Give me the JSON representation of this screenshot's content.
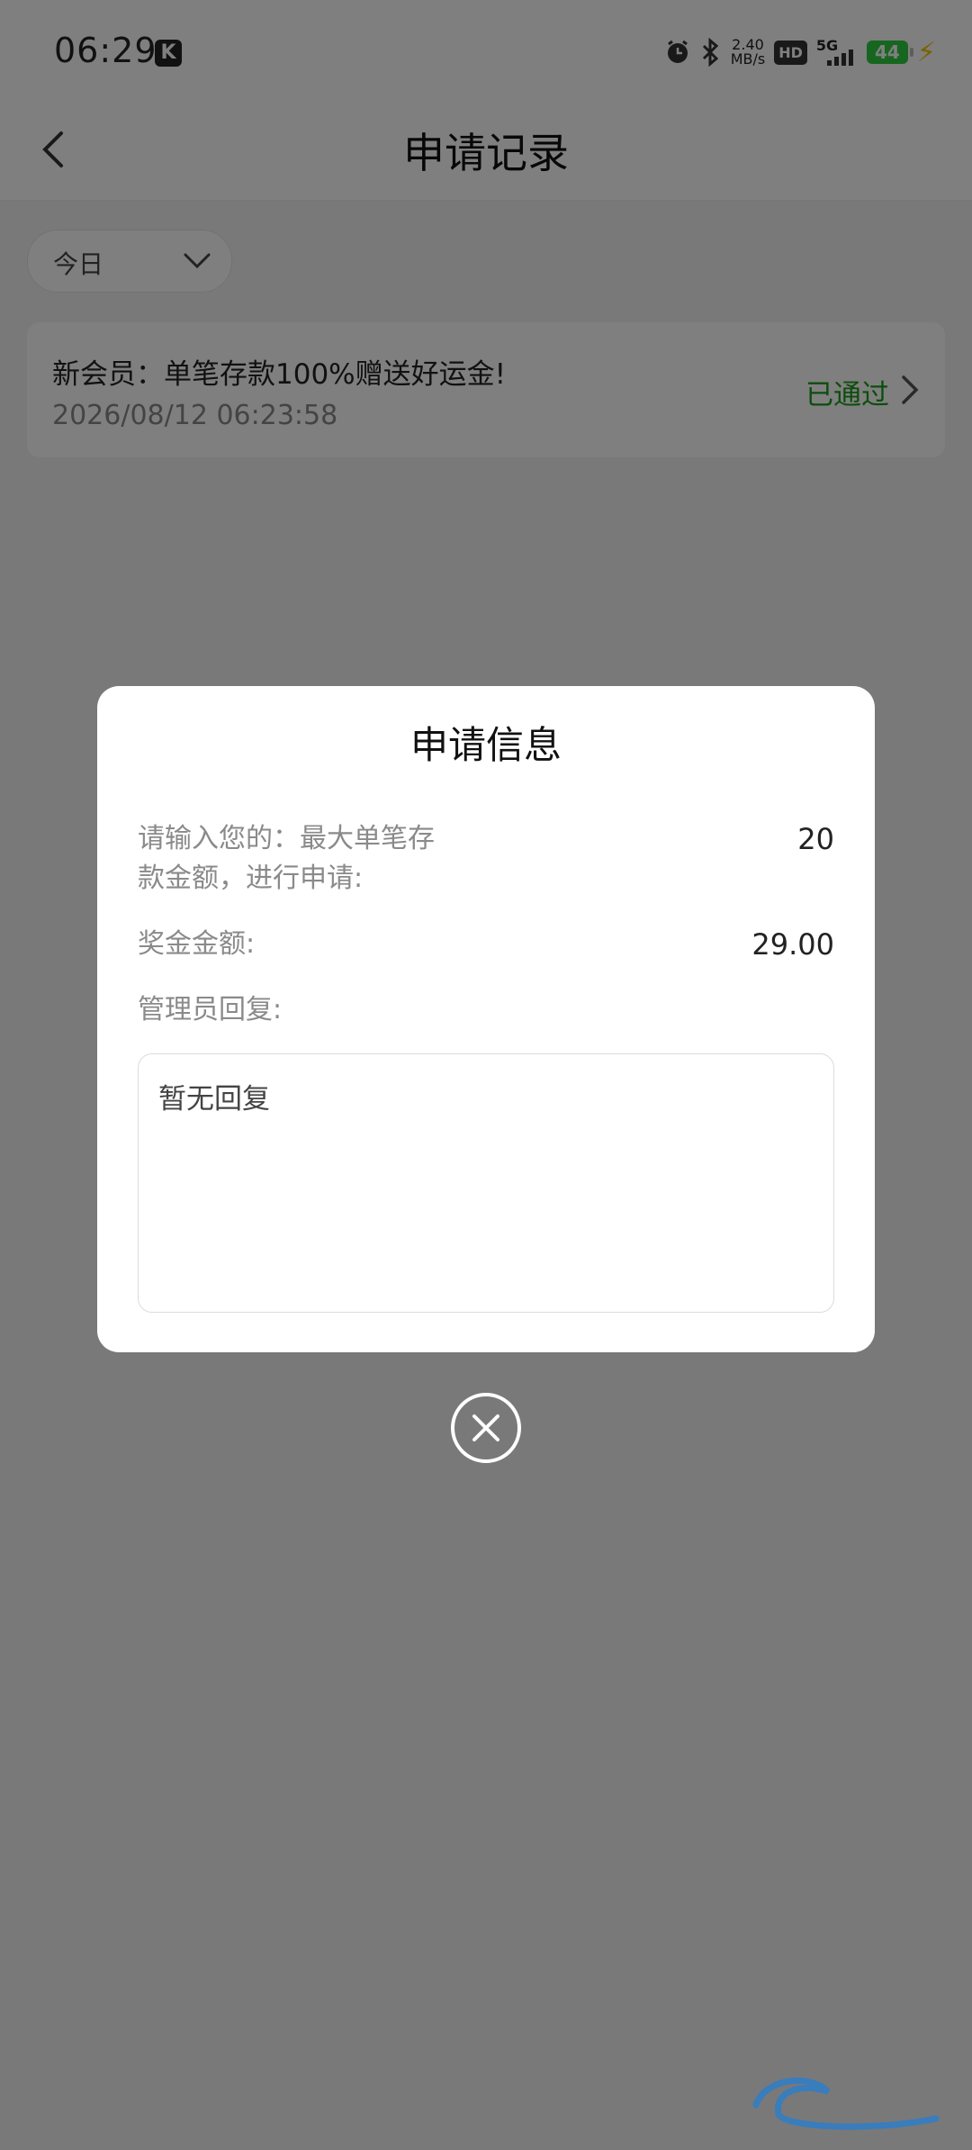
{
  "status_bar": {
    "time": "06:29",
    "app_badge": "K",
    "network_speed_value": "2.40",
    "network_speed_unit": "MB/s",
    "hd_label": "HD",
    "network_type": "5G",
    "battery_level": "44"
  },
  "header": {
    "title": "申请记录"
  },
  "filter": {
    "selected": "今日"
  },
  "records": [
    {
      "title": "新会员：单笔存款100%赠送好运金!",
      "time": "2026/08/12 06:23:58",
      "status": "已通过"
    }
  ],
  "modal": {
    "title": "申请信息",
    "deposit_label_line1": "请输入您的：最大单笔存",
    "deposit_label_line2": "款金额，进行申请:",
    "deposit_value": "20",
    "bonus_label": "奖金金额:",
    "bonus_value": "29.00",
    "reply_label": "管理员回复:",
    "reply_text": "暂无回复"
  },
  "colors": {
    "status_approved": "#1a9a1a",
    "overlay": "rgba(0,0,0,0.5)"
  },
  "icons": {
    "back": "chevron-left-icon",
    "filter": "chevron-down-icon",
    "record": "chevron-right-icon",
    "close": "close-circle-icon"
  }
}
